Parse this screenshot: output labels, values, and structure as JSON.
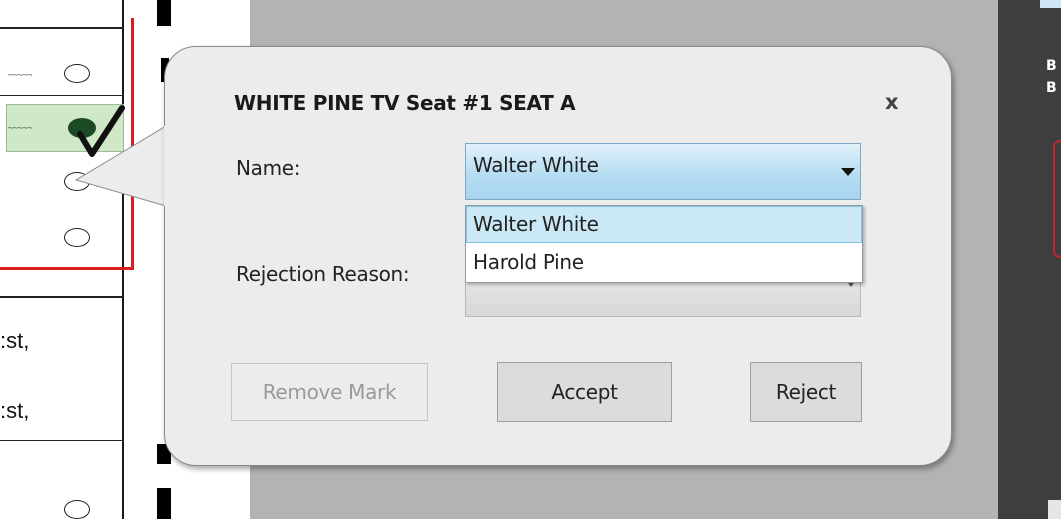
{
  "dialog": {
    "title": "WHITE PINE TV Seat #1 SEAT A",
    "close_label": "x",
    "name_label": "Name:",
    "name_value": "Walter White",
    "rejection_label": "Rejection Reason:",
    "rejection_value": "",
    "dropdown_options": [
      "Walter White",
      "Harold Pine"
    ],
    "selected_option_index": 0,
    "buttons": {
      "remove_mark": "Remove Mark",
      "accept": "Accept",
      "reject": "Reject"
    }
  },
  "background_ballot": {
    "text_fragments": [
      ":st,",
      ":st,"
    ]
  },
  "right_panel": {
    "labels": [
      "B",
      "B"
    ]
  },
  "colors": {
    "select_highlight": "#b6ddf2",
    "dialog_bg": "#ececec",
    "ballot_red_line": "#d81e1e",
    "mark_highlight": "#cfe8c8"
  }
}
